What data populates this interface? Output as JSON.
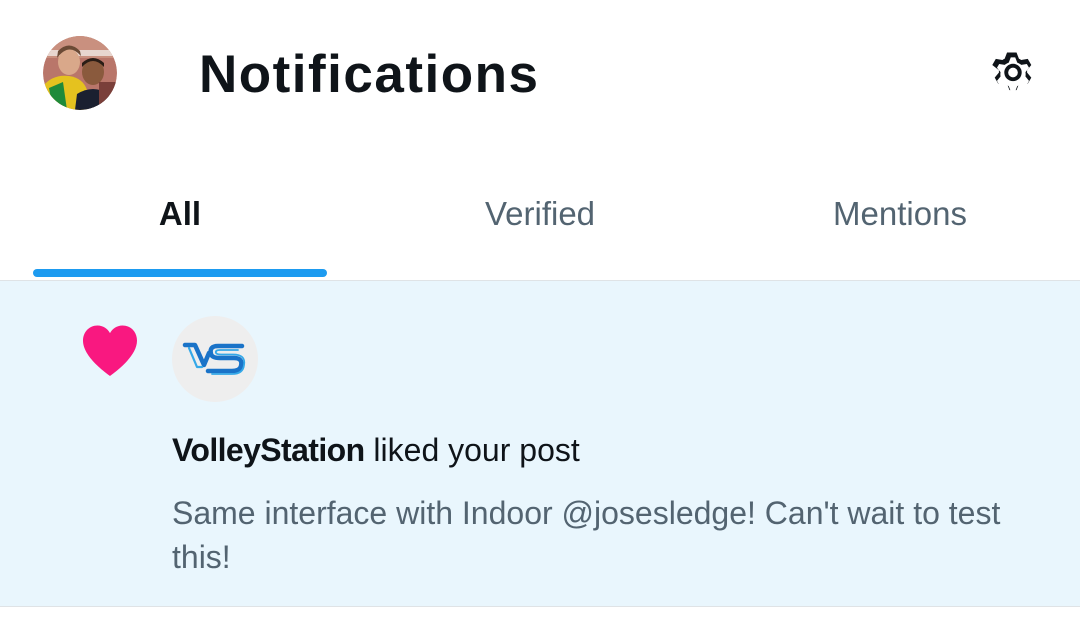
{
  "header": {
    "title": "Notifications",
    "avatar_icon": "profile-photo",
    "settings_icon": "gear-icon"
  },
  "tabs": [
    {
      "label": "All",
      "active": true
    },
    {
      "label": "Verified",
      "active": false
    },
    {
      "label": "Mentions",
      "active": false
    }
  ],
  "notifications": [
    {
      "type_icon": "heart-icon",
      "actor": "VolleyStation",
      "action": " liked your post",
      "post_text": "Same interface with Indoor @josesledge! Can't wait to test this!"
    }
  ],
  "colors": {
    "accent": "#1d9bf0",
    "like": "#f91880",
    "highlight_background": "#e9f6fd",
    "secondary_text": "#536471"
  }
}
